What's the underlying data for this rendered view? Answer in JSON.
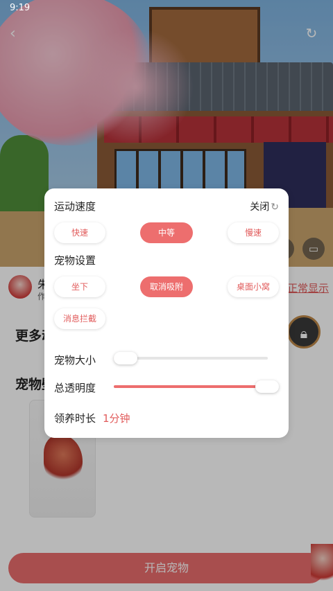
{
  "status_bar": {
    "time": "9:19"
  },
  "pet": {
    "name": "朱雀",
    "author": "作者",
    "display_link": "正常显示"
  },
  "sections": {
    "more_animations": "更多动画",
    "pet_wallpaper": "宠物壁纸"
  },
  "start_button": {
    "label": "开启宠物"
  },
  "panel": {
    "speed": {
      "title": "运动速度",
      "toggle_label": "关闭",
      "options": [
        "快速",
        "中等",
        "慢速"
      ],
      "selected": "中等"
    },
    "pet_settings": {
      "title": "宠物设置",
      "options": [
        "坐下",
        "取消吸附",
        "桌面小窝",
        "消息拦截"
      ],
      "selected": "取消吸附"
    },
    "pet_size": {
      "label": "宠物大小",
      "value_fraction": 0.05
    },
    "opacity": {
      "label": "总透明度",
      "value_fraction": 0.95
    },
    "adopt_duration": {
      "label": "领养时长",
      "value": "1分钟"
    }
  },
  "colors": {
    "accent": "#ed6e6e",
    "accent_text": "#e15b5b"
  },
  "icons": {
    "back": "back-arrow-icon",
    "refresh": "refresh-icon",
    "edit": "pencil-icon",
    "comment": "comment-icon",
    "lock": "lock-icon",
    "toggle": "rotate-arrow-icon"
  }
}
